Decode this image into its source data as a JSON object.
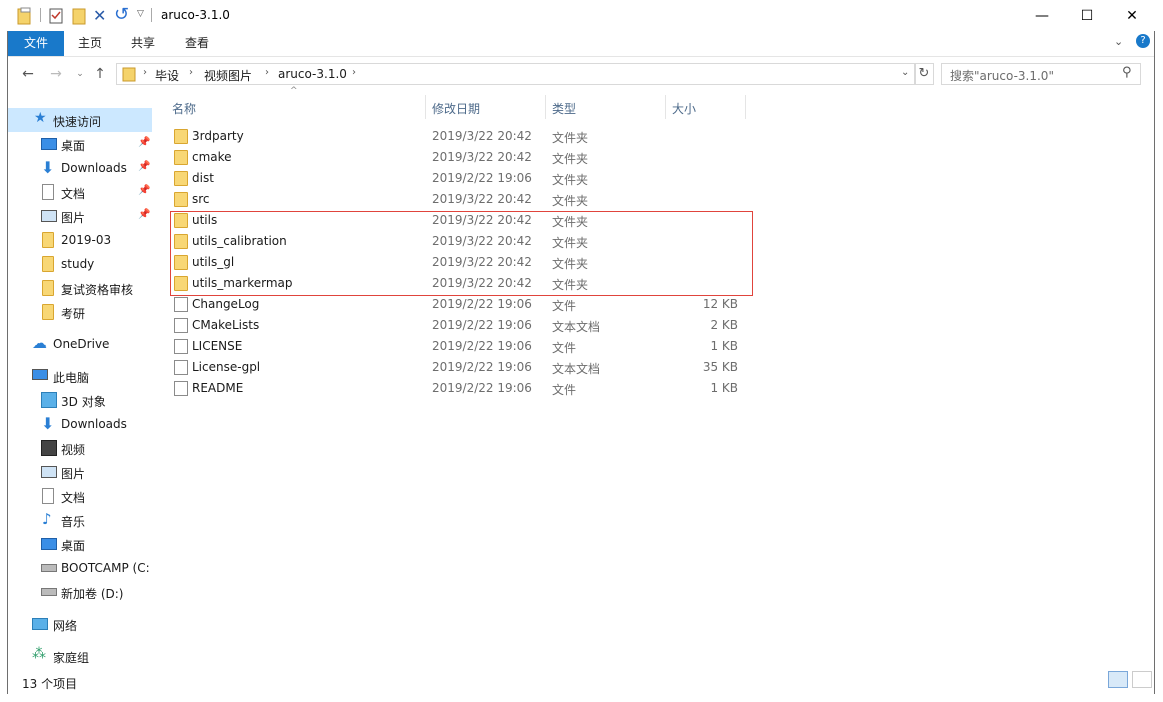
{
  "window": {
    "title": "aruco-3.1.0",
    "minimize": "—",
    "maximize": "☐",
    "close": "✕"
  },
  "ribbon": {
    "tabs": [
      "文件",
      "主页",
      "共享",
      "查看"
    ]
  },
  "address": {
    "crumbs": [
      "毕设",
      "视频图片",
      "aruco-3.1.0"
    ],
    "search_placeholder": "搜索\"aruco-3.1.0\""
  },
  "sidebar": {
    "quick_access": "快速访问",
    "quick_items": [
      "桌面",
      "Downloads",
      "文档",
      "图片",
      "2019-03",
      "study",
      "复试资格审核",
      "考研"
    ],
    "onedrive": "OneDrive",
    "this_pc": "此电脑",
    "pc_items": [
      "3D 对象",
      "Downloads",
      "视频",
      "图片",
      "文档",
      "音乐",
      "桌面",
      "BOOTCAMP (C:",
      "新加卷 (D:)"
    ],
    "network": "网络",
    "homegroup": "家庭组"
  },
  "columns": {
    "name": "名称",
    "date": "修改日期",
    "type": "类型",
    "size": "大小"
  },
  "files": [
    {
      "name": "3rdparty",
      "date": "2019/3/22 20:42",
      "type": "文件夹",
      "size": "",
      "kind": "folder"
    },
    {
      "name": "cmake",
      "date": "2019/3/22 20:42",
      "type": "文件夹",
      "size": "",
      "kind": "folder"
    },
    {
      "name": "dist",
      "date": "2019/2/22 19:06",
      "type": "文件夹",
      "size": "",
      "kind": "folder"
    },
    {
      "name": "src",
      "date": "2019/3/22 20:42",
      "type": "文件夹",
      "size": "",
      "kind": "folder"
    },
    {
      "name": "utils",
      "date": "2019/3/22 20:42",
      "type": "文件夹",
      "size": "",
      "kind": "folder"
    },
    {
      "name": "utils_calibration",
      "date": "2019/3/22 20:42",
      "type": "文件夹",
      "size": "",
      "kind": "folder"
    },
    {
      "name": "utils_gl",
      "date": "2019/3/22 20:42",
      "type": "文件夹",
      "size": "",
      "kind": "folder"
    },
    {
      "name": "utils_markermap",
      "date": "2019/3/22 20:42",
      "type": "文件夹",
      "size": "",
      "kind": "folder"
    },
    {
      "name": "ChangeLog",
      "date": "2019/2/22 19:06",
      "type": "文件",
      "size": "12 KB",
      "kind": "file"
    },
    {
      "name": "CMakeLists",
      "date": "2019/2/22 19:06",
      "type": "文本文档",
      "size": "2 KB",
      "kind": "file"
    },
    {
      "name": "LICENSE",
      "date": "2019/2/22 19:06",
      "type": "文件",
      "size": "1 KB",
      "kind": "file"
    },
    {
      "name": "License-gpl",
      "date": "2019/2/22 19:06",
      "type": "文本文档",
      "size": "35 KB",
      "kind": "file"
    },
    {
      "name": "README",
      "date": "2019/2/22 19:06",
      "type": "文件",
      "size": "1 KB",
      "kind": "file"
    }
  ],
  "status": {
    "count": "13 个项目"
  },
  "colors": {
    "accent": "#1979ca",
    "highlight": "#e0443c",
    "selected": "#cce8ff"
  }
}
